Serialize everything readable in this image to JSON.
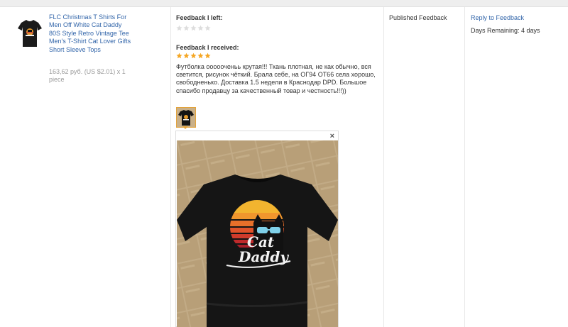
{
  "product": {
    "title": "FLC Christmas T Shirts For Men Off White Cat Daddy 80S Style Retro Vintage Tee Men's T-Shirt Cat Lover Gifts Short Sleeve Tops",
    "price": "163,62 руб. (US $2.01) x 1 piece"
  },
  "feedback": {
    "left_label": "Feedback I left:",
    "left_rating": 0,
    "received_label": "Feedback I received:",
    "received_rating": 5,
    "review_text": "Футболка оооооченьь крутая!!! Ткань плотная, не как обычно, вся светится, рисунок чёткий. Брала себе, на ОГ94 ОТ66 села хорошо, свободненько. Доставка 1.5 недели в Краснодар DPD. Большое спасибо продавцу за качественный товар и честность!!!))",
    "close_glyph": "×",
    "shirt_print_line1": "Cat",
    "shirt_print_line2": "Daddy"
  },
  "status": {
    "label": "Published Feedback"
  },
  "action": {
    "reply_label": "Reply to Feedback",
    "days_remaining": "Days Remaining: 4 days"
  },
  "colors": {
    "star_filled": "#f5a623",
    "star_empty": "#dddddd",
    "link": "#3366aa",
    "thumb_border": "#e3a33b"
  },
  "icons": {
    "star": "star-icon",
    "close": "close-icon"
  }
}
